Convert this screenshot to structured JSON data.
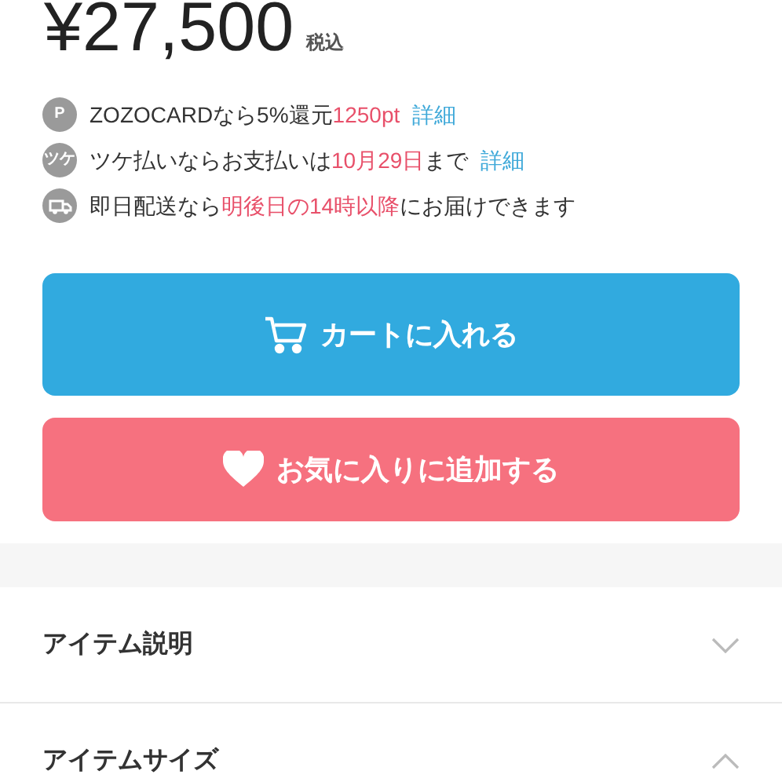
{
  "price": {
    "amount": "¥27,500",
    "tax_note": "税込"
  },
  "info_rows": [
    {
      "kind": "badge",
      "badge": "P",
      "segments": [
        {
          "kind": "plain",
          "text": "ZOZOCARDなら5%還元"
        },
        {
          "kind": "highlight",
          "text": "1250pt"
        },
        {
          "kind": "link",
          "text": "詳細"
        }
      ]
    },
    {
      "kind": "badge",
      "badge": "ツケ",
      "segments": [
        {
          "kind": "plain",
          "text": "ツケ払いならお支払いは"
        },
        {
          "kind": "highlight",
          "text": "10月29日"
        },
        {
          "kind": "plain",
          "text": "まで"
        },
        {
          "kind": "link",
          "text": "詳細"
        }
      ]
    },
    {
      "kind": "truck",
      "segments": [
        {
          "kind": "plain",
          "text": "即日配送なら"
        },
        {
          "kind": "highlight",
          "text": "明後日の14時以降"
        },
        {
          "kind": "plain",
          "text": "にお届けできます"
        }
      ]
    }
  ],
  "buttons": [
    {
      "kind": "cart",
      "label": "カートに入れる"
    },
    {
      "kind": "favorite",
      "label": "お気に入りに追加する"
    }
  ],
  "accordion": [
    {
      "title": "アイテム説明",
      "expanded": false
    },
    {
      "title": "アイテムサイズ",
      "expanded": true
    }
  ]
}
